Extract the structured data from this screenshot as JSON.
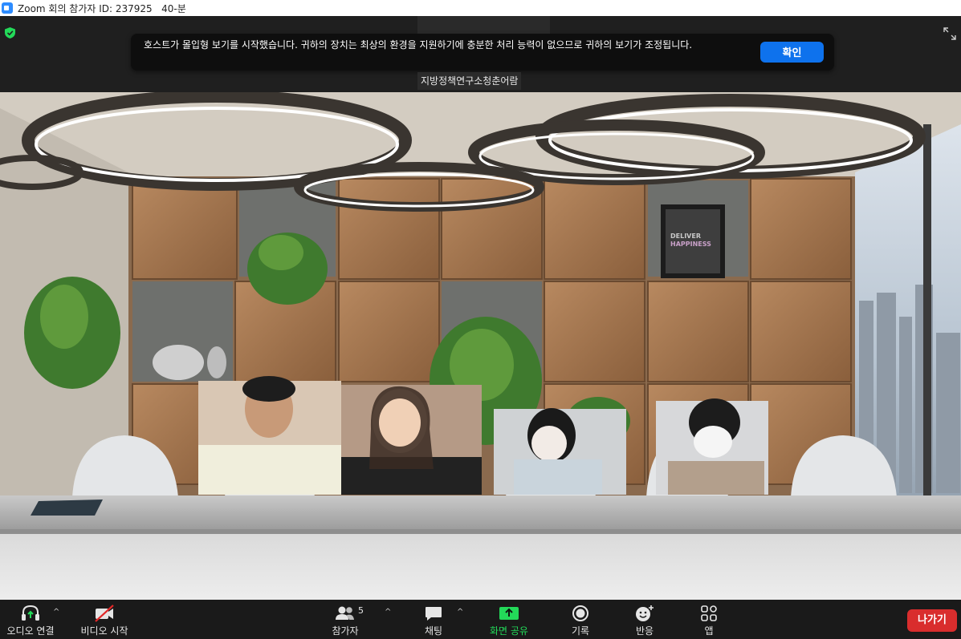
{
  "window": {
    "title": "Zoom 회의 참가자 ID: 237925   40-분"
  },
  "notice": {
    "text": "호스트가 몰입형 보기를 시작했습니다. 귀하의 장치는 최상의 환경을 지원하기에 충분한 처리 능력이 없으므로 귀하의 보기가 조정됩니다.",
    "confirm_label": "확인"
  },
  "meeting": {
    "room_label": "지방정책연구소청춘어람",
    "ghost_name": "지방정책연구소..."
  },
  "scene": {
    "poster_text_1": "DELIVER",
    "poster_text_2": "HAPPINESS"
  },
  "toolbar": {
    "audio_label": "오디오 연결",
    "video_label": "비디오 시작",
    "participants_label": "참가자",
    "participants_count": "5",
    "chat_label": "채팅",
    "share_label": "화면 공유",
    "record_label": "기록",
    "reactions_label": "반응",
    "apps_label": "앱",
    "leave_label": "나가기"
  },
  "colors": {
    "accent": "#0e72ed",
    "share_green": "#23d959",
    "leave_red": "#d92d2d",
    "toolbar_bg": "#1a1a1a"
  }
}
